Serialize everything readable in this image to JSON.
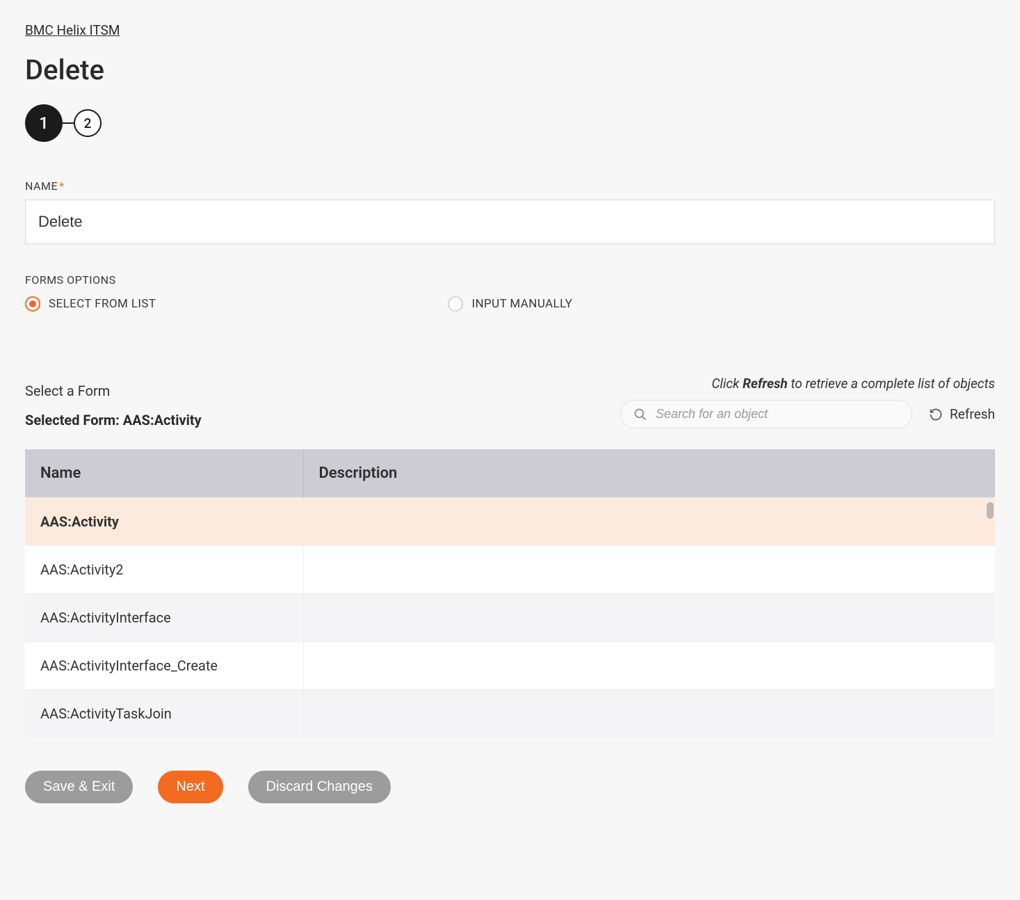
{
  "breadcrumb": {
    "label": "BMC Helix ITSM"
  },
  "page": {
    "title": "Delete"
  },
  "stepper": {
    "steps": [
      "1",
      "2"
    ],
    "active_index": 0
  },
  "name_field": {
    "label": "NAME",
    "required_mark": "*",
    "value": "Delete"
  },
  "forms_options": {
    "label": "FORMS OPTIONS",
    "options": [
      {
        "label": "SELECT FROM LIST",
        "checked": true
      },
      {
        "label": "INPUT MANUALLY",
        "checked": false
      }
    ]
  },
  "table_section": {
    "select_label": "Select a Form",
    "selected_form_prefix": "Selected Form: ",
    "selected_form_value": "AAS:Activity",
    "hint_prefix": "Click ",
    "hint_bold": "Refresh",
    "hint_suffix": " to retrieve a complete list of objects",
    "search_placeholder": "Search for an object",
    "refresh_label": "Refresh",
    "columns": {
      "name": "Name",
      "description": "Description"
    },
    "rows": [
      {
        "name": "AAS:Activity",
        "description": "",
        "selected": true
      },
      {
        "name": "AAS:Activity2",
        "description": ""
      },
      {
        "name": "AAS:ActivityInterface",
        "description": ""
      },
      {
        "name": "AAS:ActivityInterface_Create",
        "description": ""
      },
      {
        "name": "AAS:ActivityTaskJoin",
        "description": ""
      }
    ]
  },
  "footer": {
    "save_exit": "Save & Exit",
    "next": "Next",
    "discard": "Discard Changes"
  }
}
